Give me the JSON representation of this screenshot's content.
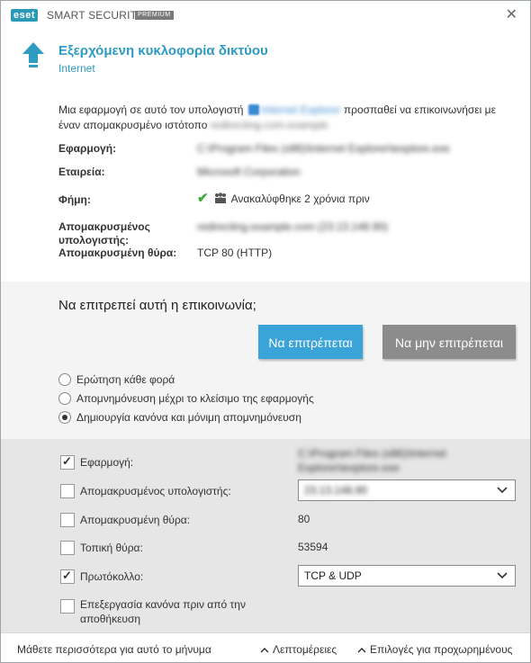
{
  "titlebar": {
    "logo": "eset",
    "product": "SMART SECURITY",
    "badge": "PREMIUM",
    "close_icon": "close-icon"
  },
  "header": {
    "title": "Εξερχόμενη κυκλοφορία δικτύου",
    "subtitle": "Internet",
    "icon": "arrow-up-icon",
    "accent_color": "#2e9bc3"
  },
  "info": {
    "message_part1": "Μια εφαρμογή σε αυτό τον υπολογιστή",
    "app_name_blurred": "Internet Explorer",
    "message_part2": "προσπαθεί να επικοινωνήσει με έναν απομακρυσμένο ιστότοπο",
    "remote_site_blurred": "redirecting.com.example",
    "fields": {
      "application_label": "Εφαρμογή:",
      "application_value": "C:\\Program Files (x86)\\Internet Explorer\\iexplore.exe",
      "company_label": "Εταιρεία:",
      "company_value": "Microsoft Corporation",
      "reputation_label": "Φήμη:",
      "reputation_value": "Ανακαλύφθηκε 2 χρόνια πριν",
      "remote_host_label": "Απομακρυσμένος υπολογιστής:",
      "remote_host_value": "redirecting.example.com (23.13.148.90)",
      "remote_port_label": "Απομακρυσμένη θύρα:",
      "remote_port_value": "TCP 80 (HTTP)"
    }
  },
  "decision": {
    "question": "Να επιτρεπεί αυτή η επικοινωνία;",
    "allow_label": "Να επιτρέπεται",
    "deny_label": "Να μην επιτρέπεται",
    "allow_color": "#3aa3d7",
    "deny_color": "#8c8c8c",
    "options": [
      {
        "label": "Ερώτηση κάθε φορά",
        "checked": false
      },
      {
        "label": "Απομνημόνευση μέχρι το κλείσιμο της εφαρμογής",
        "checked": false
      },
      {
        "label": "Δημιουργία κανόνα και μόνιμη απομνημόνευση",
        "checked": true
      }
    ]
  },
  "rule": {
    "application_label": "Εφαρμογή:",
    "application_checked": true,
    "application_value": "C:\\Program Files (x86)\\Internet Explorer\\iexplore.exe",
    "remote_host_label": "Απομακρυσμένος υπολογιστής:",
    "remote_host_checked": false,
    "remote_host_value": "23.13.148.90",
    "remote_port_label": "Απομακρυσμένη θύρα:",
    "remote_port_checked": false,
    "remote_port_value": "80",
    "local_port_label": "Τοπική θύρα:",
    "local_port_checked": false,
    "local_port_value": "53594",
    "protocol_label": "Πρωτόκολλο:",
    "protocol_checked": true,
    "protocol_value": "TCP & UDP",
    "edit_rule_label_line1": "Επεξεργασία κανόνα πριν από την",
    "edit_rule_label_line2": "αποθήκευση",
    "edit_rule_checked": false
  },
  "footer": {
    "learn_more": "Μάθετε περισσότερα για αυτό το μήνυμα",
    "details": "Λεπτομέρειες",
    "advanced": "Επιλογές για προχωρημένους"
  }
}
